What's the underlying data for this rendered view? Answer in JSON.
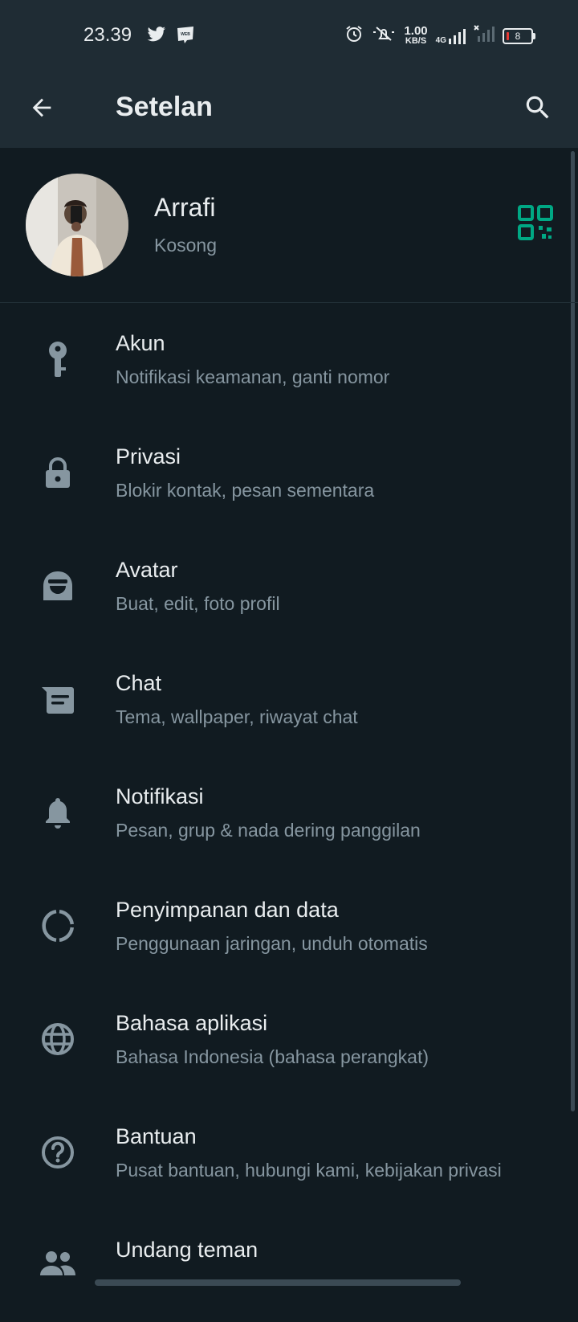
{
  "status_bar": {
    "time": "23.39",
    "net_speed_value": "1.00",
    "net_speed_unit": "KB/S",
    "network_type": "4G",
    "battery_level": "8",
    "left_icons": [
      "twitter-icon",
      "webtoon-icon"
    ],
    "right_icons": [
      "alarm-icon",
      "mute-bell-icon",
      "signal-icon",
      "signal-off-icon",
      "battery-icon"
    ]
  },
  "app_bar": {
    "title": "Setelan",
    "back_icon": "arrow-back-icon",
    "search_icon": "search-icon"
  },
  "profile": {
    "name": "Arrafi",
    "status": "Kosong",
    "qr_icon": "qr-code-icon"
  },
  "menu": [
    {
      "icon": "key-icon",
      "title": "Akun",
      "subtitle": "Notifikasi keamanan, ganti nomor"
    },
    {
      "icon": "lock-icon",
      "title": "Privasi",
      "subtitle": "Blokir kontak, pesan sementara"
    },
    {
      "icon": "avatar-face-icon",
      "title": "Avatar",
      "subtitle": "Buat, edit, foto profil"
    },
    {
      "icon": "chat-icon",
      "title": "Chat",
      "subtitle": "Tema, wallpaper, riwayat chat"
    },
    {
      "icon": "bell-icon",
      "title": "Notifikasi",
      "subtitle": "Pesan, grup & nada dering panggilan"
    },
    {
      "icon": "storage-icon",
      "title": "Penyimpanan dan data",
      "subtitle": "Penggunaan jaringan, unduh otomatis"
    },
    {
      "icon": "globe-icon",
      "title": "Bahasa aplikasi",
      "subtitle": "Bahasa Indonesia (bahasa perangkat)"
    },
    {
      "icon": "help-icon",
      "title": "Bantuan",
      "subtitle": "Pusat bantuan, hubungi kami, kebijakan privasi"
    },
    {
      "icon": "people-icon",
      "title": "Undang teman",
      "subtitle": ""
    }
  ],
  "colors": {
    "background": "#111b21",
    "bar": "#1f2c34",
    "accent": "#00a884",
    "icon": "#8696a0",
    "text_primary": "#e9edef",
    "text_secondary": "#8696a0"
  }
}
